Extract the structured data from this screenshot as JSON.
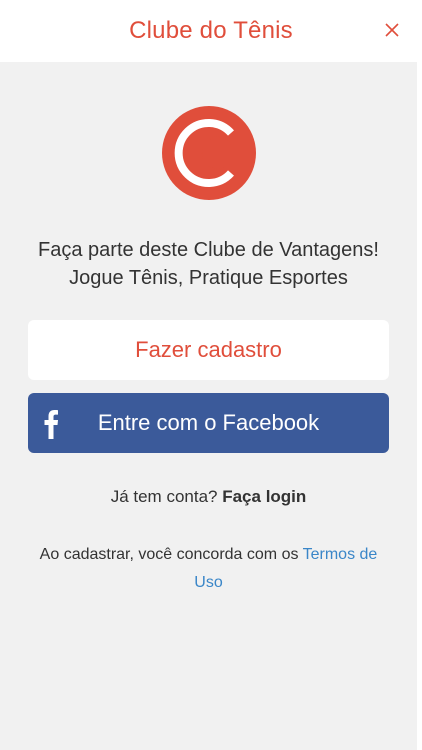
{
  "header": {
    "title": "Clube do Tênis",
    "close_icon": "close-icon"
  },
  "logo": {
    "icon": "tennis-ball-logo",
    "color": "#e04e3b"
  },
  "tagline": {
    "line1": "Faça parte deste Clube de Vantagens!",
    "line2": "Jogue Tênis, Pratique Esportes"
  },
  "buttons": {
    "signup_label": "Fazer cadastro",
    "facebook_label": "Entre com o Facebook",
    "facebook_icon": "facebook-icon"
  },
  "login": {
    "prompt": "Já tem conta?",
    "link": "Faça login"
  },
  "terms": {
    "text": "Ao cadastrar, você concorda com os",
    "link": "Termos de Uso"
  },
  "colors": {
    "brand_red": "#e04e3b",
    "facebook_blue": "#3b5a9a",
    "link_blue": "#3a86c8",
    "background": "#f1f1f1"
  }
}
